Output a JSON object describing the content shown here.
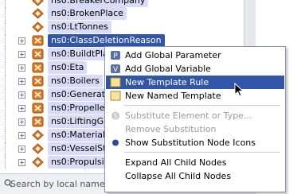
{
  "tree": {
    "rows": [
      {
        "label": "ns0:BreakerCompany",
        "expander": ""
      },
      {
        "label": "ns0:BrokenPlace",
        "expander": ""
      },
      {
        "label": "ns0:LtTonnes",
        "expander": ""
      },
      {
        "label": "ns0:ClassDeletionReason",
        "expander": "+"
      },
      {
        "label": "ns0:BuildtPla",
        "expander": "+"
      },
      {
        "label": "ns0:Eta",
        "expander": "+"
      },
      {
        "label": "ns0:Boilers",
        "expander": "+"
      },
      {
        "label": "ns0:Generato",
        "expander": "+"
      },
      {
        "label": "ns0:Propelle",
        "expander": "+"
      },
      {
        "label": "ns0:LiftingG",
        "expander": "+"
      },
      {
        "label": "ns0:Material",
        "expander": "+"
      },
      {
        "label": "ns0:VesselSt",
        "expander": "+"
      },
      {
        "label": "ns0:Propulsi",
        "expander": "+"
      }
    ]
  },
  "search": {
    "placeholder": "Search by local name"
  },
  "context_menu": {
    "items": [
      {
        "label": "Add Global Parameter",
        "icon": "add-parameter-icon"
      },
      {
        "label": "Add Global Variable",
        "icon": "add-variable-icon"
      },
      {
        "label": "New Template Rule",
        "icon": "template-rule-icon"
      },
      {
        "label": "New Named Template",
        "icon": "named-template-icon"
      },
      {
        "label": "Substitute Element or Type...",
        "icon": "substitute-icon"
      },
      {
        "label": "Remove Substitution",
        "icon": ""
      },
      {
        "label": "Show Substitution Node Icons",
        "icon": "radio-dot-icon"
      },
      {
        "label": "Expand All Child Nodes",
        "icon": ""
      },
      {
        "label": "Collapse All Child Nodes",
        "icon": ""
      }
    ]
  },
  "colors": {
    "selection": "#3355a8",
    "node_highlight": "#d9dcf7",
    "icon_orange": "#e07a20"
  }
}
